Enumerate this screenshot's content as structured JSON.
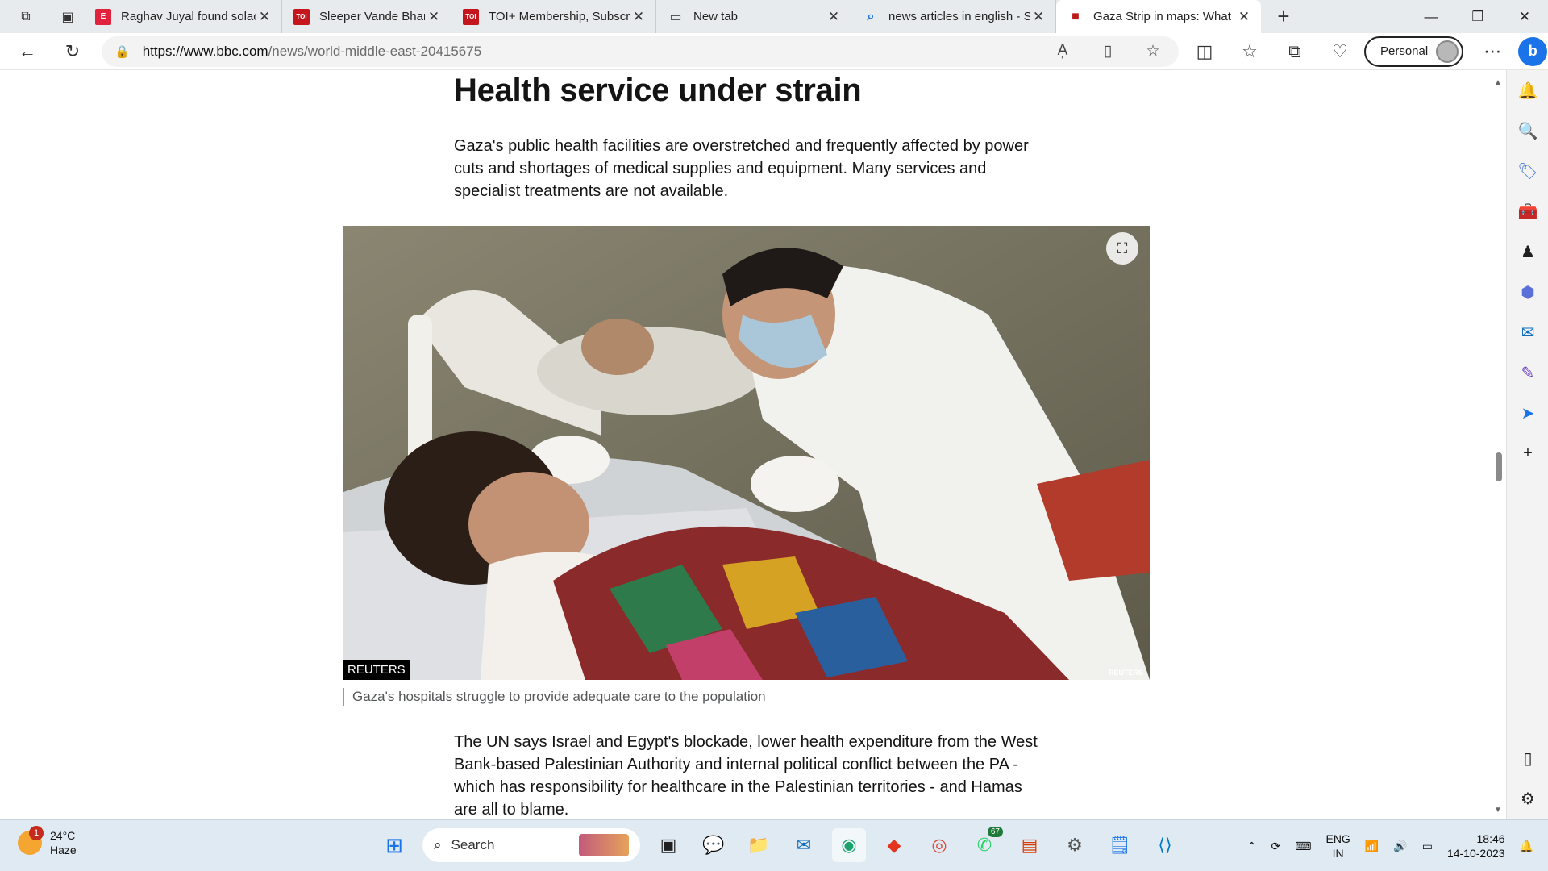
{
  "browser": {
    "tabs": [
      {
        "title": "Raghav Juyal found solace",
        "favicon_text": "E",
        "favicon_color": "#e0223c",
        "active": false
      },
      {
        "title": "Sleeper Vande Bharat will c",
        "favicon_text": "TOI",
        "favicon_color": "#c4161c",
        "active": false
      },
      {
        "title": "TOI+ Membership, Subscri",
        "favicon_text": "TOI",
        "favicon_color": "#c4161c",
        "active": false
      },
      {
        "title": "New tab",
        "favicon_text": "▭",
        "favicon_color": "#444444",
        "active": false
      },
      {
        "title": "news articles in english - S",
        "favicon_text": "⌕",
        "favicon_color": "#1a73e8",
        "active": false
      },
      {
        "title": "Gaza Strip in maps: What it",
        "favicon_text": "■",
        "favicon_color": "#bb1919",
        "active": true
      }
    ],
    "url_host": "https://www.bbc.com",
    "url_path": "/news/world-middle-east-20415675",
    "profile_label": "Personal"
  },
  "article": {
    "heading": "Health service under strain",
    "para1": "Gaza's public health facilities are overstretched and frequently affected by power cuts and shortages of medical supplies and equipment. Many services and specialist treatments are not available.",
    "image_credit": "REUTERS",
    "image_watermark": "REUTERS",
    "caption": "Gaza's hospitals struggle to provide adequate care to the population",
    "para2": "The UN says Israel and Egypt's blockade, lower health expenditure from the West Bank-based Palestinian Authority and internal political conflict between the PA - which has responsibility for healthcare in the Palestinian territories - and Hamas are all to blame."
  },
  "taskbar": {
    "weather_temp": "24°C",
    "weather_desc": "Haze",
    "weather_badge": "1",
    "search_label": "Search",
    "whatsapp_count": "67",
    "lang_top": "ENG",
    "lang_bottom": "IN",
    "time": "18:46",
    "date": "14-10-2023"
  },
  "colors": {
    "bbc_red": "#bb1919",
    "taskbar_bg": "#dfeaf3",
    "tabstrip_bg": "#e8ebee"
  }
}
